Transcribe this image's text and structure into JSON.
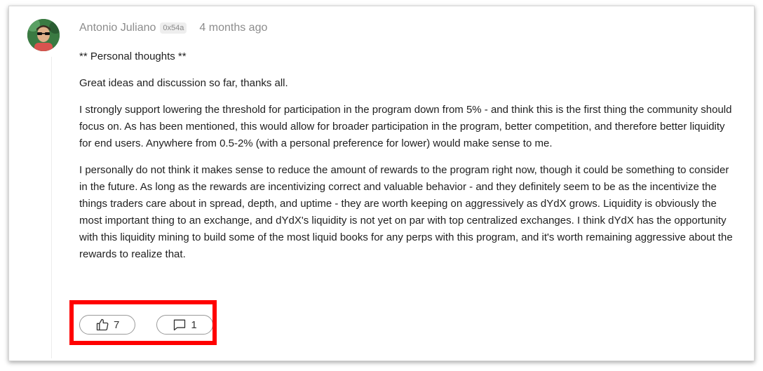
{
  "post": {
    "author": "Antonio Juliano",
    "badge": "0x54a",
    "time": "4 months ago",
    "paragraphs": [
      "** Personal thoughts **",
      "Great ideas and discussion so far, thanks all.",
      "I strongly support lowering the threshold for participation in the program down from 5% - and think this is the first thing the community should focus on. As has been mentioned, this would allow for broader participation in the program, better competition, and therefore better liquidity for end users. Anywhere from 0.5-2% (with a personal preference for lower) would make sense to me.",
      "I personally do not think it makes sense to reduce the amount of rewards to the program right now, though it could be something to consider in the future. As long as the rewards are incentivizing correct and valuable behavior - and they definitely seem to be as the incentivize the things traders care about in spread, depth, and uptime - they are worth keeping on aggressively as dYdX grows. Liquidity is obviously the most important thing to an exchange, and dYdX's liquidity is not yet on par with top centralized exchanges. I think dYdX has the opportunity with this liquidity mining to build some of the most liquid books for any perps with this program, and it's worth remaining aggressive about the rewards to realize that."
    ],
    "likes": "7",
    "comments": "1"
  },
  "icons": {
    "like": "thumbs-up-icon",
    "comment": "comment-icon"
  },
  "colors": {
    "highlight": "#ff0000",
    "meta_text": "#8c8c8c",
    "body_text": "#1f1f1f"
  }
}
